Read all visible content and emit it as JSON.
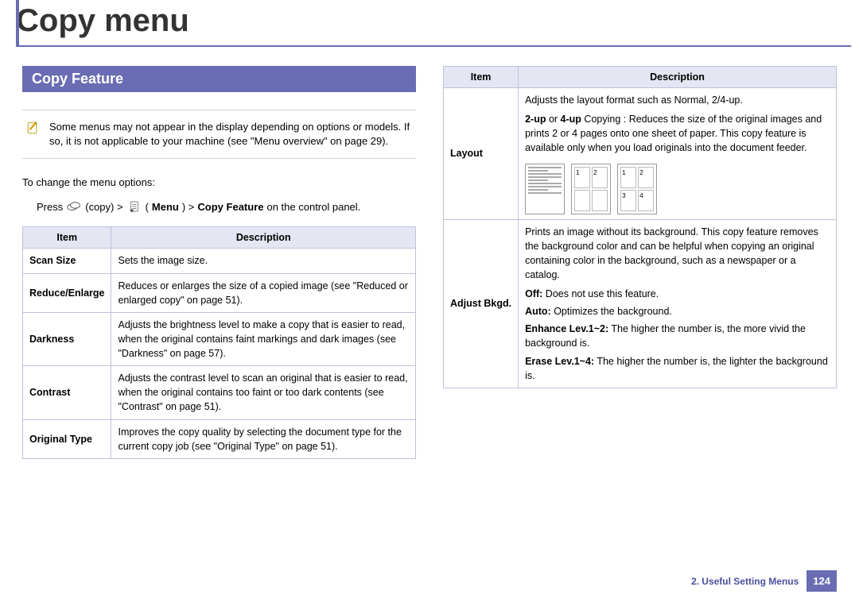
{
  "pageTitle": "Copy menu",
  "sectionTitle": "Copy Feature",
  "note": "Some menus may not appear in the display depending on options or models. If so, it is not applicable to your machine (see \"Menu overview\" on page 29).",
  "intro": "To change the menu options:",
  "press": {
    "pre": "Press",
    "copyAfter": "(copy) >",
    "menuPre": "(",
    "menuBold": "Menu",
    "menuPost": ") >",
    "featureBold": "Copy Feature",
    "tail": " on the control panel."
  },
  "headers": {
    "item": "Item",
    "desc": "Description"
  },
  "left": [
    {
      "item": "Scan Size",
      "desc": "Sets the image size."
    },
    {
      "item": "Reduce/Enlarge",
      "desc": "Reduces or enlarges the size of a copied image (see \"Reduced or enlarged copy\" on page 51)."
    },
    {
      "item": "Darkness",
      "desc": "Adjusts the brightness level to make a copy that is easier to read, when the original contains faint markings and dark images (see \"Darkness\" on page 57)."
    },
    {
      "item": "Contrast",
      "desc": "Adjusts the contrast level to scan an original that is easier to read, when the original contains too faint or too dark contents (see \"Contrast\" on page 51)."
    },
    {
      "item": "Original Type",
      "desc": "Improves the copy quality by selecting the document type for the current copy job (see \"Original Type\" on page 51)."
    }
  ],
  "right": {
    "layout": {
      "item": "Layout",
      "line1": "Adjusts the layout format such as Normal, 2/4-up.",
      "bold2": "2-up",
      "mid2": " or ",
      "bold2b": "4-up",
      "rest2": " Copying : Reduces the size of the original images and prints 2 or 4 pages onto one sheet of paper. This copy feature is available only when you load originals into the document feeder."
    },
    "adjust": {
      "item": "Adjust Bkgd.",
      "p1": "Prints an image without its background. This copy feature removes the background color and can be helpful when copying an original containing color in the background, such as a newspaper or a catalog.",
      "offBold": "Off:",
      "offRest": " Does not use this feature.",
      "autoBold": "Auto:",
      "autoRest": " Optimizes the background.",
      "enhBold": "Enhance Lev.1~2:",
      "enhRest": " The higher the number is, the more vivid the background is.",
      "eraBold": "Erase Lev.1~4:",
      "eraRest": " The higher the number is, the lighter the background is."
    }
  },
  "footer": {
    "chapter": "2.  Useful Setting Menus",
    "page": "124"
  },
  "figCells": [
    "1",
    "2",
    "3",
    "4"
  ]
}
